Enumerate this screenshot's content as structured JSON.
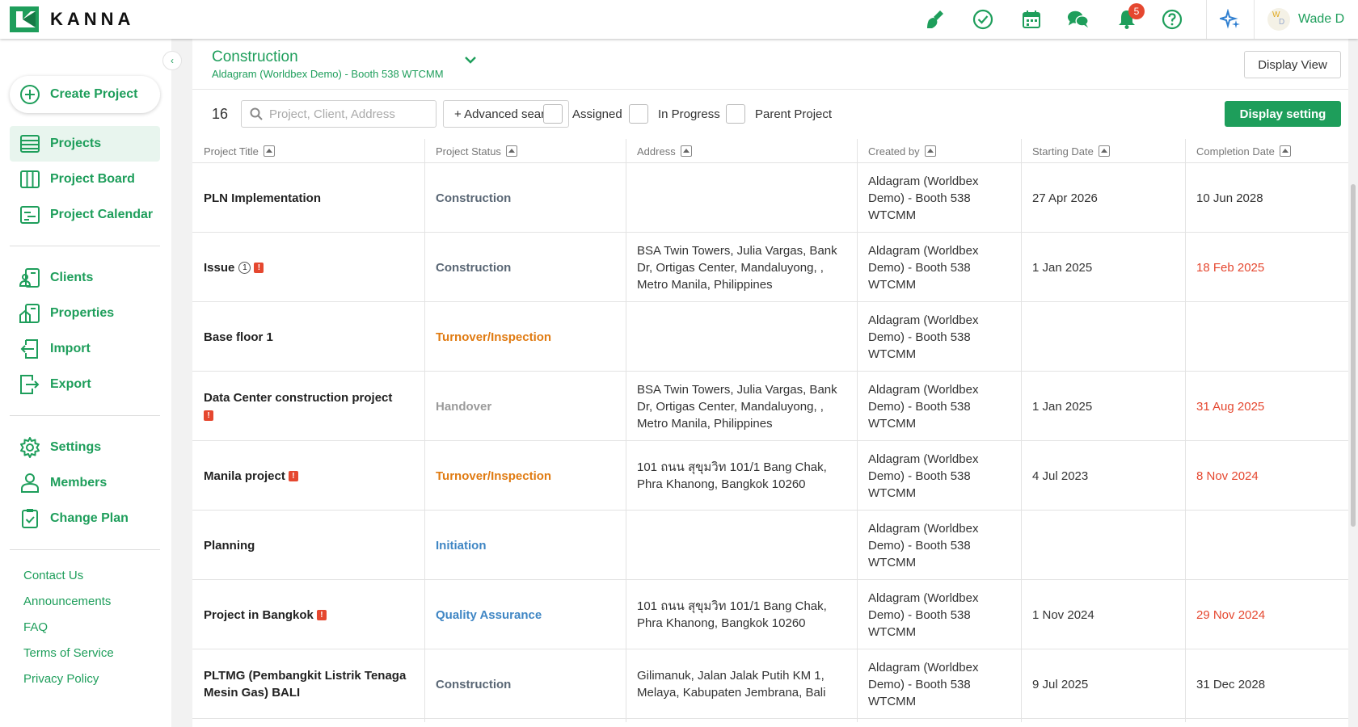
{
  "brand": {
    "name": "KANNA",
    "accent": "#1e9e5b"
  },
  "header": {
    "icons": [
      "broom-icon",
      "check-circle-icon",
      "calendar-icon",
      "chat-icon",
      "bell-icon",
      "help-icon",
      "sparkle-icon"
    ],
    "notification_count": "5",
    "avatar_initials": [
      "W",
      "D"
    ],
    "user_name": "Wade D"
  },
  "sidebar": {
    "create_label": "Create Project",
    "nav_primary": [
      {
        "label": "Projects",
        "active": true
      },
      {
        "label": "Project Board"
      },
      {
        "label": "Project Calendar"
      }
    ],
    "nav_secondary": [
      {
        "label": "Clients"
      },
      {
        "label": "Properties"
      },
      {
        "label": "Import"
      },
      {
        "label": "Export"
      }
    ],
    "nav_tertiary": [
      {
        "label": "Settings"
      },
      {
        "label": "Members"
      },
      {
        "label": "Change Plan"
      }
    ],
    "footer_links": [
      "Contact Us",
      "Announcements",
      "FAQ",
      "Terms of Service",
      "Privacy Policy"
    ]
  },
  "main": {
    "view_title": "Construction",
    "view_subtitle": "Aldagram (Worldbex Demo) - Booth 538 WTCMM",
    "display_view_label": "Display View",
    "result_count": "16",
    "search_placeholder": "Project, Client, Address",
    "advanced_search_label": "+ Advanced search",
    "filters": [
      "Assigned",
      "In Progress",
      "Parent Project"
    ],
    "display_setting_label": "Display setting"
  },
  "status_colors": {
    "Construction": "#5a6775",
    "Turnover/Inspection": "#e07b12",
    "Handover": "#9a9a9a",
    "Initiation": "#3f86c4",
    "Quality Assurance": "#3f86c4"
  },
  "overdue_color": "#e5472f",
  "table": {
    "columns": [
      "Project Title",
      "Project Status",
      "Address",
      "Created by",
      "Starting Date",
      "Completion Date"
    ],
    "rows": [
      {
        "title": "PLN Implementation",
        "status": "Construction",
        "address": "",
        "created_by": "Aldagram (Worldbex Demo) - Booth 538 WTCMM",
        "start": "27 Apr 2026",
        "completion": "10 Jun 2028",
        "overdue": false,
        "flags": []
      },
      {
        "title": "Issue",
        "status": "Construction",
        "address": "BSA Twin Towers, Julia Vargas, Bank Dr, Ortigas Center, Mandaluyong, , Metro Manila, Philippines",
        "created_by": "Aldagram (Worldbex Demo) - Booth 538 WTCMM",
        "start": "1 Jan 2025",
        "completion": "18 Feb 2025",
        "overdue": true,
        "flags": [
          "one",
          "warn"
        ]
      },
      {
        "title": "Base floor 1",
        "status": "Turnover/Inspection",
        "address": "",
        "created_by": "Aldagram (Worldbex Demo) - Booth 538 WTCMM",
        "start": "",
        "completion": "",
        "overdue": false,
        "flags": []
      },
      {
        "title": "Data Center construction project",
        "status": "Handover",
        "address": "BSA Twin Towers, Julia Vargas, Bank Dr, Ortigas Center, Mandaluyong, , Metro Manila, Philippines",
        "created_by": "Aldagram (Worldbex Demo) - Booth 538 WTCMM",
        "start": "1 Jan 2025",
        "completion": "31 Aug 2025",
        "overdue": true,
        "flags": [
          "warn-break"
        ]
      },
      {
        "title": "Manila project",
        "status": "Turnover/Inspection",
        "address": "101 ถนน สุขุมวิท 101/1 Bang Chak, Phra Khanong, Bangkok 10260",
        "created_by": "Aldagram (Worldbex Demo) - Booth 538 WTCMM",
        "start": "4 Jul 2023",
        "completion": "8 Nov 2024",
        "overdue": true,
        "flags": [
          "warn"
        ]
      },
      {
        "title": "Planning",
        "status": "Initiation",
        "address": "",
        "created_by": "Aldagram (Worldbex Demo) - Booth 538 WTCMM",
        "start": "",
        "completion": "",
        "overdue": false,
        "flags": []
      },
      {
        "title": "Project in Bangkok",
        "status": "Quality Assurance",
        "address": "101 ถนน สุขุมวิท 101/1 Bang Chak, Phra Khanong, Bangkok 10260",
        "created_by": "Aldagram (Worldbex Demo) - Booth 538 WTCMM",
        "start": "1 Nov 2024",
        "completion": "29 Nov 2024",
        "overdue": true,
        "flags": [
          "warn"
        ]
      },
      {
        "title": "PLTMG (Pembangkit Listrik Tenaga Mesin Gas) BALI",
        "status": "Construction",
        "address": "Gilimanuk, Jalan Jalak Putih KM 1, Melaya, Kabupaten Jembrana, Bali",
        "created_by": "Aldagram (Worldbex Demo) - Booth 538 WTCMM",
        "start": "9 Jul 2025",
        "completion": "31 Dec 2028",
        "overdue": false,
        "flags": []
      }
    ]
  }
}
